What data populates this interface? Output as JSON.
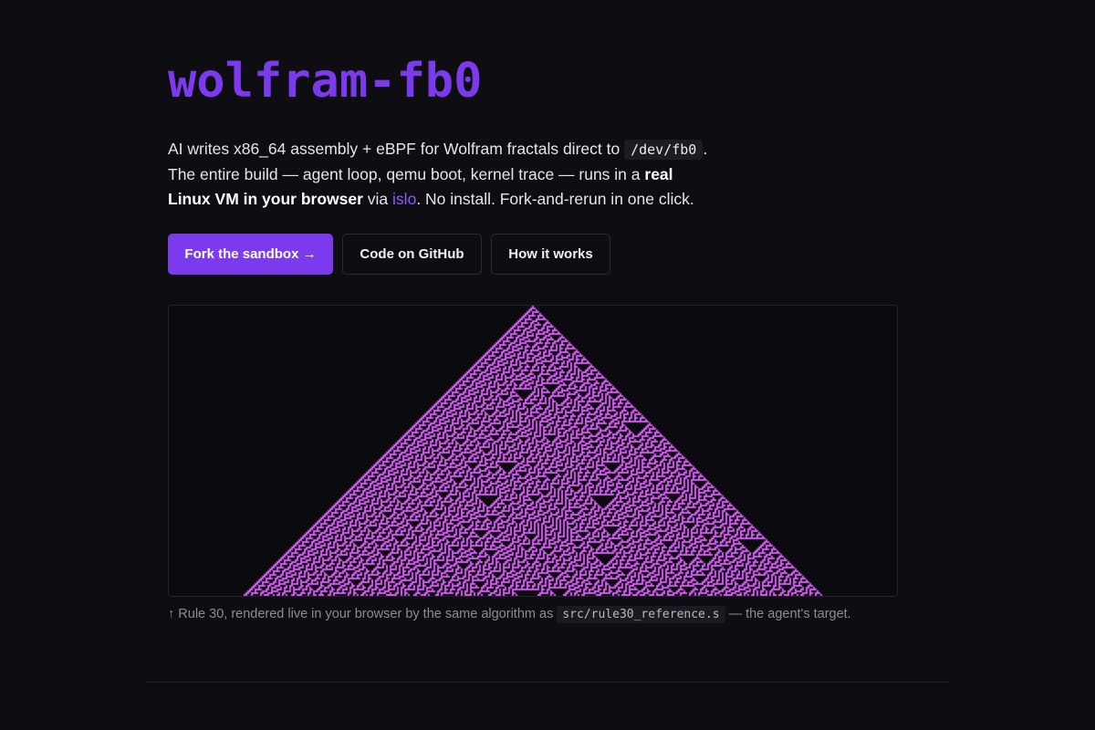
{
  "header": {
    "title": "wolfram-fb0"
  },
  "intro": {
    "line1_text": "AI writes x86_64 assembly + eBPF for Wolfram fractals direct to",
    "line1_code": "/dev/fb0",
    "line1_end": ".",
    "line2_text": "The entire build — agent loop, qemu boot, kernel trace — runs in a",
    "line2_bold": "real",
    "line3_bold": "Linux VM in your browser",
    "line3_via": "via",
    "line3_link": "islo",
    "line3_end": ". No install. Fork-and-rerun in one click."
  },
  "buttons": {
    "fork": "Fork the sandbox →",
    "github": "Code on GitHub",
    "how": "How it works"
  },
  "visualization": {
    "rule": 30,
    "cell_color": "#d35cf0",
    "background_color": "#0a0a0f"
  },
  "caption": {
    "prefix": "↑ Rule 30, rendered live in your browser by the same algorithm as",
    "code": "src/rule30_reference.s",
    "suffix": "— the agent's target."
  },
  "colors": {
    "accent": "#7c3aed",
    "link": "#8b5cf6",
    "background": "#0e0d12"
  }
}
